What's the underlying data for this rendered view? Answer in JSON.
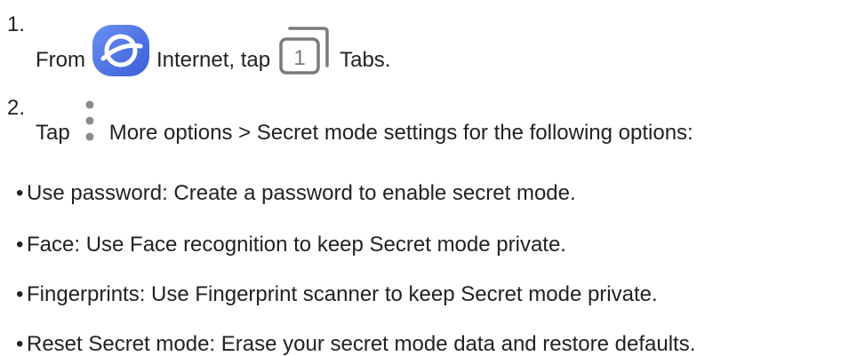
{
  "steps": [
    {
      "number": "1.",
      "text_before": "From",
      "icon1": "samsung-internet-icon",
      "text_mid": "Internet, tap",
      "icon2": "tabs-icon",
      "icon2_digit": "1",
      "text_after": "Tabs."
    },
    {
      "number": "2.",
      "text_before": "Tap",
      "icon1": "more-options-icon",
      "text_after": "More options > Secret mode settings for the following options:"
    }
  ],
  "bullets": [
    {
      "symbol": "•",
      "text": "Use password: Create a password to enable secret mode."
    },
    {
      "symbol": "•",
      "text": "Face: Use Face recognition to keep Secret mode private."
    },
    {
      "symbol": "•",
      "text": "Fingerprints: Use Fingerprint scanner to keep Secret mode private."
    },
    {
      "symbol": "•",
      "text": "Reset Secret mode: Erase your secret mode data and restore defaults."
    }
  ],
  "colors": {
    "text": "#222222",
    "internet_icon_blue": "#4a7de6",
    "icon_gray": "#7a7a7a"
  }
}
